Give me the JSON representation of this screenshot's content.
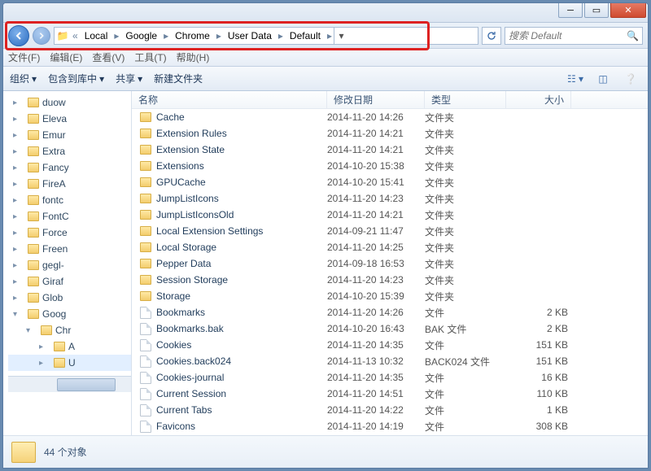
{
  "breadcrumb": [
    "Local",
    "Google",
    "Chrome",
    "User Data",
    "Default"
  ],
  "search_placeholder": "搜索 Default",
  "menubar": [
    "文件(F)",
    "编辑(E)",
    "查看(V)",
    "工具(T)",
    "帮助(H)"
  ],
  "cmdbar": {
    "organize": "组织",
    "include": "包含到库中",
    "share": "共享",
    "new_folder": "新建文件夹"
  },
  "columns": {
    "name": "名称",
    "date": "修改日期",
    "type": "类型",
    "size": "大小"
  },
  "tree": [
    {
      "label": "duow",
      "ind": 0
    },
    {
      "label": "Eleva",
      "ind": 0
    },
    {
      "label": "Emur",
      "ind": 0
    },
    {
      "label": "Extra",
      "ind": 0
    },
    {
      "label": "Fancy",
      "ind": 0
    },
    {
      "label": "FireA",
      "ind": 0
    },
    {
      "label": "fontc",
      "ind": 0
    },
    {
      "label": "FontC",
      "ind": 0
    },
    {
      "label": "Force",
      "ind": 0
    },
    {
      "label": "Freen",
      "ind": 0
    },
    {
      "label": "gegl-",
      "ind": 0
    },
    {
      "label": "Giraf",
      "ind": 0
    },
    {
      "label": "Glob",
      "ind": 0
    },
    {
      "label": "Goog",
      "ind": 0,
      "exp": true
    },
    {
      "label": "Chr",
      "ind": 1,
      "exp": true
    },
    {
      "label": "A",
      "ind": 2
    },
    {
      "label": "U",
      "ind": 2,
      "sel": true
    }
  ],
  "files": [
    {
      "name": "Cache",
      "date": "2014-11-20 14:26",
      "type": "文件夹",
      "size": "",
      "folder": true
    },
    {
      "name": "Extension Rules",
      "date": "2014-11-20 14:21",
      "type": "文件夹",
      "size": "",
      "folder": true
    },
    {
      "name": "Extension State",
      "date": "2014-11-20 14:21",
      "type": "文件夹",
      "size": "",
      "folder": true
    },
    {
      "name": "Extensions",
      "date": "2014-10-20 15:38",
      "type": "文件夹",
      "size": "",
      "folder": true
    },
    {
      "name": "GPUCache",
      "date": "2014-10-20 15:41",
      "type": "文件夹",
      "size": "",
      "folder": true
    },
    {
      "name": "JumpListIcons",
      "date": "2014-11-20 14:23",
      "type": "文件夹",
      "size": "",
      "folder": true
    },
    {
      "name": "JumpListIconsOld",
      "date": "2014-11-20 14:21",
      "type": "文件夹",
      "size": "",
      "folder": true
    },
    {
      "name": "Local Extension Settings",
      "date": "2014-09-21 11:47",
      "type": "文件夹",
      "size": "",
      "folder": true
    },
    {
      "name": "Local Storage",
      "date": "2014-11-20 14:25",
      "type": "文件夹",
      "size": "",
      "folder": true
    },
    {
      "name": "Pepper Data",
      "date": "2014-09-18 16:53",
      "type": "文件夹",
      "size": "",
      "folder": true
    },
    {
      "name": "Session Storage",
      "date": "2014-11-20 14:23",
      "type": "文件夹",
      "size": "",
      "folder": true
    },
    {
      "name": "Storage",
      "date": "2014-10-20 15:39",
      "type": "文件夹",
      "size": "",
      "folder": true
    },
    {
      "name": "Bookmarks",
      "date": "2014-11-20 14:26",
      "type": "文件",
      "size": "2 KB",
      "folder": false
    },
    {
      "name": "Bookmarks.bak",
      "date": "2014-10-20 16:43",
      "type": "BAK 文件",
      "size": "2 KB",
      "folder": false
    },
    {
      "name": "Cookies",
      "date": "2014-11-20 14:35",
      "type": "文件",
      "size": "151 KB",
      "folder": false
    },
    {
      "name": "Cookies.back024",
      "date": "2014-11-13 10:32",
      "type": "BACK024 文件",
      "size": "151 KB",
      "folder": false
    },
    {
      "name": "Cookies-journal",
      "date": "2014-11-20 14:35",
      "type": "文件",
      "size": "16 KB",
      "folder": false
    },
    {
      "name": "Current Session",
      "date": "2014-11-20 14:51",
      "type": "文件",
      "size": "110 KB",
      "folder": false
    },
    {
      "name": "Current Tabs",
      "date": "2014-11-20 14:22",
      "type": "文件",
      "size": "1 KB",
      "folder": false
    },
    {
      "name": "Favicons",
      "date": "2014-11-20 14:19",
      "type": "文件",
      "size": "308 KB",
      "folder": false
    }
  ],
  "status": "44 个对象"
}
